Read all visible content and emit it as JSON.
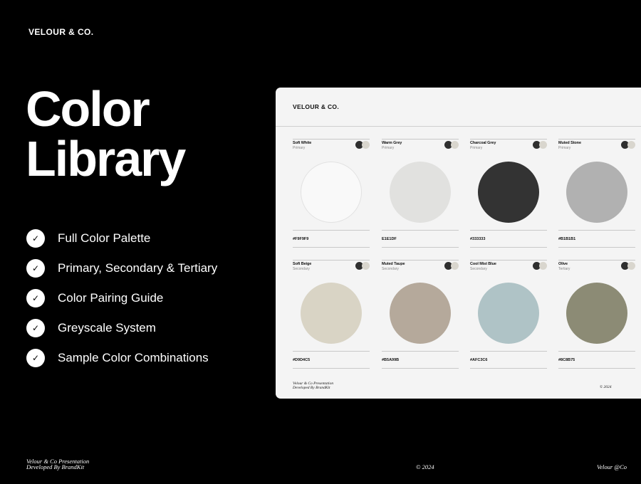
{
  "brand": "VELOUR & CO.",
  "title": {
    "line1": "Color",
    "line2": "Library"
  },
  "features": [
    "Full Color Palette",
    "Primary, Secondary & Tertiary",
    "Color Pairing Guide",
    "Greyscale System",
    "Sample Color Combinations"
  ],
  "check_glyph": "✓",
  "footer": {
    "left_line1": "Velour & Co Presentation",
    "left_line2": "Developed By BrandKit",
    "middle": "© 2024",
    "right": "Velour @Co"
  },
  "card": {
    "brand": "VELOUR & CO.",
    "footer_line1": "Velour & Co Presentation",
    "footer_line2": "Developed By BrandKit",
    "copyright": "© 2024",
    "swatches": [
      {
        "name": "Soft White",
        "tier": "Primary",
        "hex": "#F9F9F9",
        "color": "#F9F9F9"
      },
      {
        "name": "Warm Grey",
        "tier": "Primary",
        "hex": "E1E1DF",
        "color": "#E1E1DF"
      },
      {
        "name": "Charcoal Grey",
        "tier": "Primary",
        "hex": "#333333",
        "color": "#333333"
      },
      {
        "name": "Muted Stone",
        "tier": "Primary",
        "hex": "#B1B1B1",
        "color": "#B1B1B1"
      },
      {
        "name": "Soft Beige",
        "tier": "Secondary",
        "hex": "#D9D4C5",
        "color": "#D9D4C5"
      },
      {
        "name": "Muted Taupe",
        "tier": "Secondary",
        "hex": "#B5A99B",
        "color": "#B5A99B"
      },
      {
        "name": "Cool Mist Blue",
        "tier": "Secondary",
        "hex": "#AFC3C6",
        "color": "#AFC3C6"
      },
      {
        "name": "Olive",
        "tier": "Tertiary",
        "hex": "#8C8B75",
        "color": "#8C8B75"
      }
    ]
  },
  "colors": {
    "background": "#000000",
    "card": "#F4F4F4",
    "text": "#FFFFFF"
  }
}
